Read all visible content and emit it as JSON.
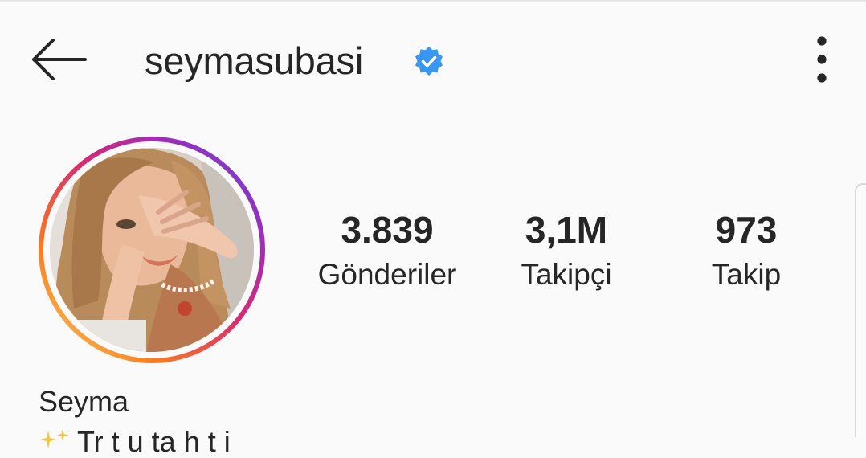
{
  "header": {
    "username": "seymasubasi",
    "back_icon": "arrow-left-icon",
    "verified_icon": "verified-badge-icon",
    "more_icon": "vertical-ellipsis-icon",
    "verified_color": "#3897f0"
  },
  "profile": {
    "avatar_icon": "profile-photo",
    "story_ring_colors": [
      "#feda75",
      "#fa7e1e",
      "#d62976",
      "#962fbf"
    ],
    "display_name": "Seyma",
    "bio_icon": "sparkles-emoji-icon",
    "bio_text": "Tr t u ta h t i"
  },
  "stats": [
    {
      "value": "3.839",
      "label": "Gönderiler"
    },
    {
      "value": "3,1M",
      "label": "Takipçi"
    },
    {
      "value": "973",
      "label": "Takip"
    }
  ]
}
